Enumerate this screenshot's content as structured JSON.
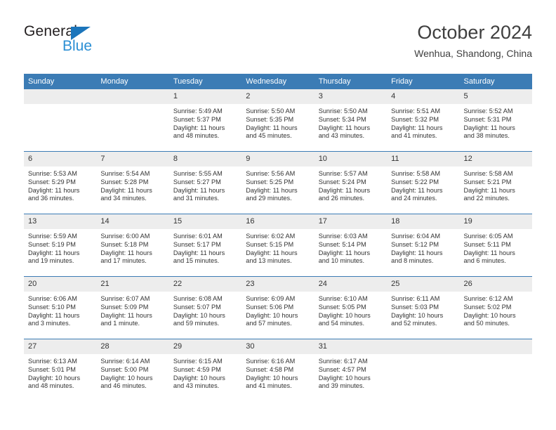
{
  "brand": {
    "name_part1": "General",
    "name_part2": "Blue",
    "accent_color": "#1b75bb",
    "logo_blue": "#2b8fd4"
  },
  "header": {
    "title": "October 2024",
    "subtitle": "Wenhua, Shandong, China",
    "header_bg": "#3c7cb5",
    "daynum_bg": "#ededed"
  },
  "weekdays": [
    "Sunday",
    "Monday",
    "Tuesday",
    "Wednesday",
    "Thursday",
    "Friday",
    "Saturday"
  ],
  "weeks": [
    [
      {
        "day": "",
        "sunrise": "",
        "sunset": "",
        "daylight1": "",
        "daylight2": "",
        "blank": true
      },
      {
        "day": "",
        "sunrise": "",
        "sunset": "",
        "daylight1": "",
        "daylight2": "",
        "blank": true
      },
      {
        "day": "1",
        "sunrise": "Sunrise: 5:49 AM",
        "sunset": "Sunset: 5:37 PM",
        "daylight1": "Daylight: 11 hours",
        "daylight2": "and 48 minutes."
      },
      {
        "day": "2",
        "sunrise": "Sunrise: 5:50 AM",
        "sunset": "Sunset: 5:35 PM",
        "daylight1": "Daylight: 11 hours",
        "daylight2": "and 45 minutes."
      },
      {
        "day": "3",
        "sunrise": "Sunrise: 5:50 AM",
        "sunset": "Sunset: 5:34 PM",
        "daylight1": "Daylight: 11 hours",
        "daylight2": "and 43 minutes."
      },
      {
        "day": "4",
        "sunrise": "Sunrise: 5:51 AM",
        "sunset": "Sunset: 5:32 PM",
        "daylight1": "Daylight: 11 hours",
        "daylight2": "and 41 minutes."
      },
      {
        "day": "5",
        "sunrise": "Sunrise: 5:52 AM",
        "sunset": "Sunset: 5:31 PM",
        "daylight1": "Daylight: 11 hours",
        "daylight2": "and 38 minutes."
      }
    ],
    [
      {
        "day": "6",
        "sunrise": "Sunrise: 5:53 AM",
        "sunset": "Sunset: 5:29 PM",
        "daylight1": "Daylight: 11 hours",
        "daylight2": "and 36 minutes."
      },
      {
        "day": "7",
        "sunrise": "Sunrise: 5:54 AM",
        "sunset": "Sunset: 5:28 PM",
        "daylight1": "Daylight: 11 hours",
        "daylight2": "and 34 minutes."
      },
      {
        "day": "8",
        "sunrise": "Sunrise: 5:55 AM",
        "sunset": "Sunset: 5:27 PM",
        "daylight1": "Daylight: 11 hours",
        "daylight2": "and 31 minutes."
      },
      {
        "day": "9",
        "sunrise": "Sunrise: 5:56 AM",
        "sunset": "Sunset: 5:25 PM",
        "daylight1": "Daylight: 11 hours",
        "daylight2": "and 29 minutes."
      },
      {
        "day": "10",
        "sunrise": "Sunrise: 5:57 AM",
        "sunset": "Sunset: 5:24 PM",
        "daylight1": "Daylight: 11 hours",
        "daylight2": "and 26 minutes."
      },
      {
        "day": "11",
        "sunrise": "Sunrise: 5:58 AM",
        "sunset": "Sunset: 5:22 PM",
        "daylight1": "Daylight: 11 hours",
        "daylight2": "and 24 minutes."
      },
      {
        "day": "12",
        "sunrise": "Sunrise: 5:58 AM",
        "sunset": "Sunset: 5:21 PM",
        "daylight1": "Daylight: 11 hours",
        "daylight2": "and 22 minutes."
      }
    ],
    [
      {
        "day": "13",
        "sunrise": "Sunrise: 5:59 AM",
        "sunset": "Sunset: 5:19 PM",
        "daylight1": "Daylight: 11 hours",
        "daylight2": "and 19 minutes."
      },
      {
        "day": "14",
        "sunrise": "Sunrise: 6:00 AM",
        "sunset": "Sunset: 5:18 PM",
        "daylight1": "Daylight: 11 hours",
        "daylight2": "and 17 minutes."
      },
      {
        "day": "15",
        "sunrise": "Sunrise: 6:01 AM",
        "sunset": "Sunset: 5:17 PM",
        "daylight1": "Daylight: 11 hours",
        "daylight2": "and 15 minutes."
      },
      {
        "day": "16",
        "sunrise": "Sunrise: 6:02 AM",
        "sunset": "Sunset: 5:15 PM",
        "daylight1": "Daylight: 11 hours",
        "daylight2": "and 13 minutes."
      },
      {
        "day": "17",
        "sunrise": "Sunrise: 6:03 AM",
        "sunset": "Sunset: 5:14 PM",
        "daylight1": "Daylight: 11 hours",
        "daylight2": "and 10 minutes."
      },
      {
        "day": "18",
        "sunrise": "Sunrise: 6:04 AM",
        "sunset": "Sunset: 5:12 PM",
        "daylight1": "Daylight: 11 hours",
        "daylight2": "and 8 minutes."
      },
      {
        "day": "19",
        "sunrise": "Sunrise: 6:05 AM",
        "sunset": "Sunset: 5:11 PM",
        "daylight1": "Daylight: 11 hours",
        "daylight2": "and 6 minutes."
      }
    ],
    [
      {
        "day": "20",
        "sunrise": "Sunrise: 6:06 AM",
        "sunset": "Sunset: 5:10 PM",
        "daylight1": "Daylight: 11 hours",
        "daylight2": "and 3 minutes."
      },
      {
        "day": "21",
        "sunrise": "Sunrise: 6:07 AM",
        "sunset": "Sunset: 5:09 PM",
        "daylight1": "Daylight: 11 hours",
        "daylight2": "and 1 minute."
      },
      {
        "day": "22",
        "sunrise": "Sunrise: 6:08 AM",
        "sunset": "Sunset: 5:07 PM",
        "daylight1": "Daylight: 10 hours",
        "daylight2": "and 59 minutes."
      },
      {
        "day": "23",
        "sunrise": "Sunrise: 6:09 AM",
        "sunset": "Sunset: 5:06 PM",
        "daylight1": "Daylight: 10 hours",
        "daylight2": "and 57 minutes."
      },
      {
        "day": "24",
        "sunrise": "Sunrise: 6:10 AM",
        "sunset": "Sunset: 5:05 PM",
        "daylight1": "Daylight: 10 hours",
        "daylight2": "and 54 minutes."
      },
      {
        "day": "25",
        "sunrise": "Sunrise: 6:11 AM",
        "sunset": "Sunset: 5:03 PM",
        "daylight1": "Daylight: 10 hours",
        "daylight2": "and 52 minutes."
      },
      {
        "day": "26",
        "sunrise": "Sunrise: 6:12 AM",
        "sunset": "Sunset: 5:02 PM",
        "daylight1": "Daylight: 10 hours",
        "daylight2": "and 50 minutes."
      }
    ],
    [
      {
        "day": "27",
        "sunrise": "Sunrise: 6:13 AM",
        "sunset": "Sunset: 5:01 PM",
        "daylight1": "Daylight: 10 hours",
        "daylight2": "and 48 minutes."
      },
      {
        "day": "28",
        "sunrise": "Sunrise: 6:14 AM",
        "sunset": "Sunset: 5:00 PM",
        "daylight1": "Daylight: 10 hours",
        "daylight2": "and 46 minutes."
      },
      {
        "day": "29",
        "sunrise": "Sunrise: 6:15 AM",
        "sunset": "Sunset: 4:59 PM",
        "daylight1": "Daylight: 10 hours",
        "daylight2": "and 43 minutes."
      },
      {
        "day": "30",
        "sunrise": "Sunrise: 6:16 AM",
        "sunset": "Sunset: 4:58 PM",
        "daylight1": "Daylight: 10 hours",
        "daylight2": "and 41 minutes."
      },
      {
        "day": "31",
        "sunrise": "Sunrise: 6:17 AM",
        "sunset": "Sunset: 4:57 PM",
        "daylight1": "Daylight: 10 hours",
        "daylight2": "and 39 minutes."
      },
      {
        "day": "",
        "sunrise": "",
        "sunset": "",
        "daylight1": "",
        "daylight2": "",
        "blank": true
      },
      {
        "day": "",
        "sunrise": "",
        "sunset": "",
        "daylight1": "",
        "daylight2": "",
        "blank": true
      }
    ]
  ]
}
